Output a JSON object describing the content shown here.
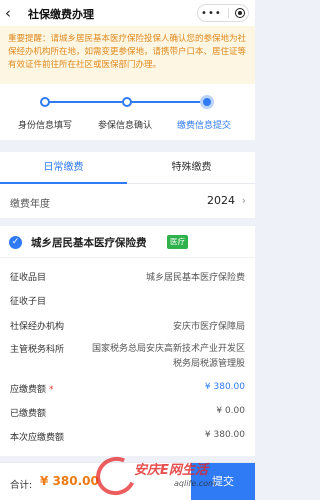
{
  "header": {
    "back_icon": "chevron-left-icon",
    "title": "社保缴费办理",
    "more_icon": "more-dots-icon",
    "close_icon": "target-icon"
  },
  "notice": {
    "text": "重要提醒：请城乡居民基本医疗保险投保人确认您的参保地为社保经办机构所在地，如需变更参保地，请携带户口本、居住证等有效证件前往所在社区或医保部门办理。",
    "color": "#e08a1e"
  },
  "steps": [
    {
      "label": "身份信息填写",
      "state": "done"
    },
    {
      "label": "参保信息确认",
      "state": "done"
    },
    {
      "label": "缴费信息提交",
      "state": "active"
    }
  ],
  "tabs": [
    {
      "label": "日常缴费",
      "active": true
    },
    {
      "label": "特殊缴费",
      "active": false
    }
  ],
  "year": {
    "label": "缴费年度",
    "value": "2024"
  },
  "card": {
    "title": "城乡居民基本医疗保险费",
    "tag": "医疗",
    "rows": [
      {
        "key": "征收品目",
        "value": "城乡居民基本医疗保险费"
      },
      {
        "key": "征收子目",
        "value": ""
      },
      {
        "key": "社保经办机构",
        "value": "安庆市医疗保障局"
      },
      {
        "key": "主管税务科所",
        "value": "国家税务总局安庆高新技术产业开发区税务局税源管理股"
      },
      {
        "key": "应缴费额",
        "value": "¥ 380.00",
        "required": true
      },
      {
        "key": "已缴费额",
        "value": "¥ 0.00"
      },
      {
        "key": "本次应缴费额",
        "value": "¥ 380.00"
      }
    ]
  },
  "footer": {
    "total_label": "合计:",
    "total_value": "¥ 380.00",
    "submit_label": "提交"
  },
  "watermark": {
    "text": "安庆E网生活",
    "url": "aqlife.com"
  },
  "colors": {
    "accent": "#2f7bf5",
    "tag_green": "#2fb24c",
    "total_orange": "#ee7a12"
  }
}
